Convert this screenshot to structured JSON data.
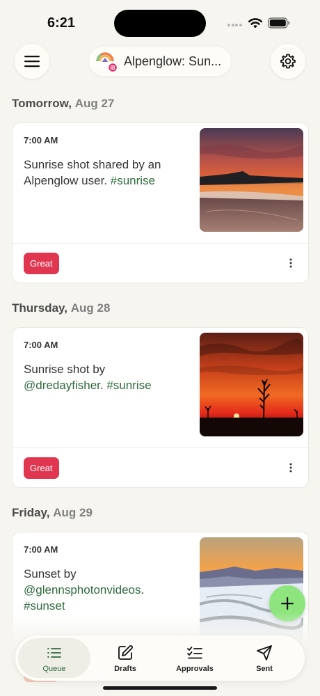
{
  "status_bar": {
    "time": "6:21"
  },
  "header": {
    "menu_icon": "hamburger-menu-icon",
    "channel_name": "Alpenglow: Sun...",
    "channel_network_icon": "instagram-icon",
    "settings_icon": "gear-icon"
  },
  "days": [
    {
      "dow": "Tomorrow,",
      "date": "Aug 27",
      "post": {
        "time": "7:00 AM",
        "text": "Sunrise shot shared by an Alpenglow user.",
        "hashtags": "#sunrise",
        "badge": "Great",
        "image": "sunrise-beach-photo"
      }
    },
    {
      "dow": "Thursday,",
      "date": "Aug 28",
      "post": {
        "time": "7:00 AM",
        "text_prefix": "Sunrise shot by",
        "mention": "@dredayfisher",
        "text_suffix": ".",
        "hashtags": "#sunrise",
        "badge": "Great",
        "image": "red-sunrise-silhouette-photo"
      }
    },
    {
      "dow": "Friday,",
      "date": "Aug 29",
      "post": {
        "time": "7:00 AM",
        "text_prefix": "Sunset by",
        "mention": "@glennsphotonvideos",
        "text_suffix": ".",
        "hashtags": "#sunset",
        "image": "snowy-mountain-sunset-photo"
      }
    }
  ],
  "fab": {
    "icon": "plus-icon"
  },
  "tabs": [
    {
      "label": "Queue",
      "icon": "queue-list-icon",
      "active": true
    },
    {
      "label": "Drafts",
      "icon": "edit-icon",
      "active": false
    },
    {
      "label": "Approvals",
      "icon": "checklist-icon",
      "active": false
    },
    {
      "label": "Sent",
      "icon": "send-icon",
      "active": false
    }
  ],
  "colors": {
    "background": "#f6f5f0",
    "hashtag": "#2e6b3c",
    "badge_great": "#e0364f",
    "fab": "#8ee57e",
    "active_tab_label": "#2e6b3c"
  }
}
